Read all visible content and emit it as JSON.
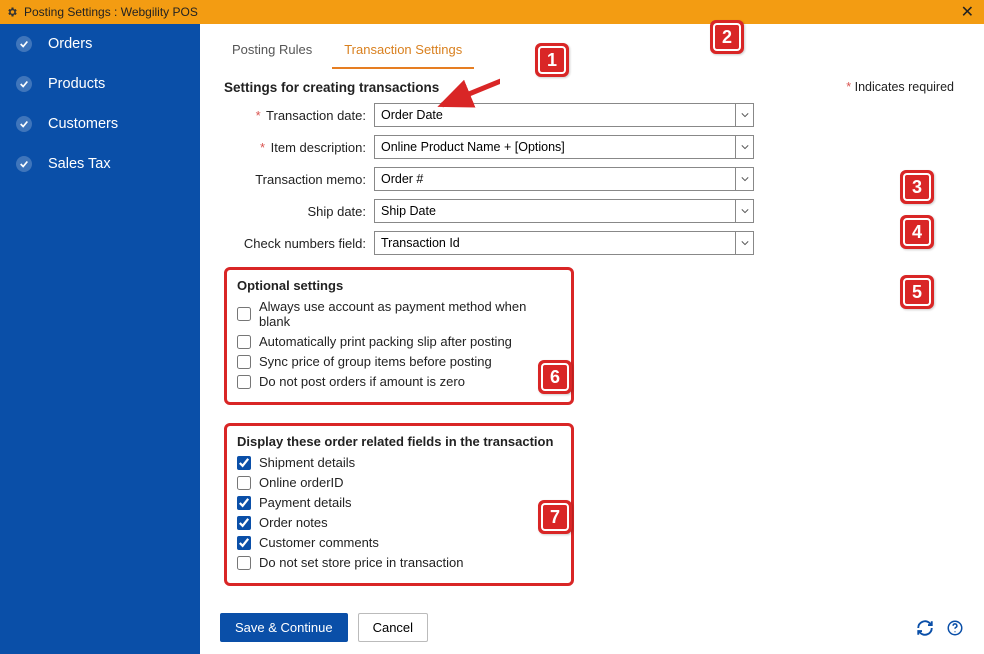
{
  "window": {
    "title": "Posting Settings : Webgility POS"
  },
  "sidebar": {
    "items": [
      {
        "label": "Orders"
      },
      {
        "label": "Products"
      },
      {
        "label": "Customers"
      },
      {
        "label": "Sales Tax"
      }
    ]
  },
  "tabs": [
    {
      "label": "Posting Rules"
    },
    {
      "label": "Transaction Settings"
    }
  ],
  "section_heading": "Settings for creating transactions",
  "required_note_prefix": "*",
  "required_note_text": " Indicates required",
  "fields": {
    "transaction_date": {
      "label": "Transaction date:",
      "value": "Order Date",
      "required": true
    },
    "item_description": {
      "label": "Item description:",
      "value": "Online Product Name + [Options]",
      "required": true
    },
    "transaction_memo": {
      "label": "Transaction memo:",
      "value": "Order #",
      "required": false
    },
    "ship_date": {
      "label": "Ship date:",
      "value": "Ship Date",
      "required": false
    },
    "check_numbers": {
      "label": "Check numbers field:",
      "value": "Transaction Id",
      "required": false
    }
  },
  "optional_group": {
    "heading": "Optional settings",
    "items": [
      {
        "label": "Always use account as payment method when blank",
        "checked": false
      },
      {
        "label": "Automatically print packing slip after posting",
        "checked": false
      },
      {
        "label": "Sync price of group items before posting",
        "checked": false
      },
      {
        "label": "Do not post orders if amount is zero",
        "checked": false
      }
    ]
  },
  "display_group": {
    "heading": "Display these order related fields in the transaction",
    "items": [
      {
        "label": "Shipment details",
        "checked": true
      },
      {
        "label": "Online orderID",
        "checked": false
      },
      {
        "label": "Payment details",
        "checked": true
      },
      {
        "label": "Order notes",
        "checked": true
      },
      {
        "label": "Customer comments",
        "checked": true
      },
      {
        "label": "Do not set store price in transaction",
        "checked": false
      }
    ]
  },
  "footer": {
    "save": "Save & Continue",
    "cancel": "Cancel"
  },
  "callouts": [
    "1",
    "2",
    "3",
    "4",
    "5",
    "6",
    "7"
  ]
}
